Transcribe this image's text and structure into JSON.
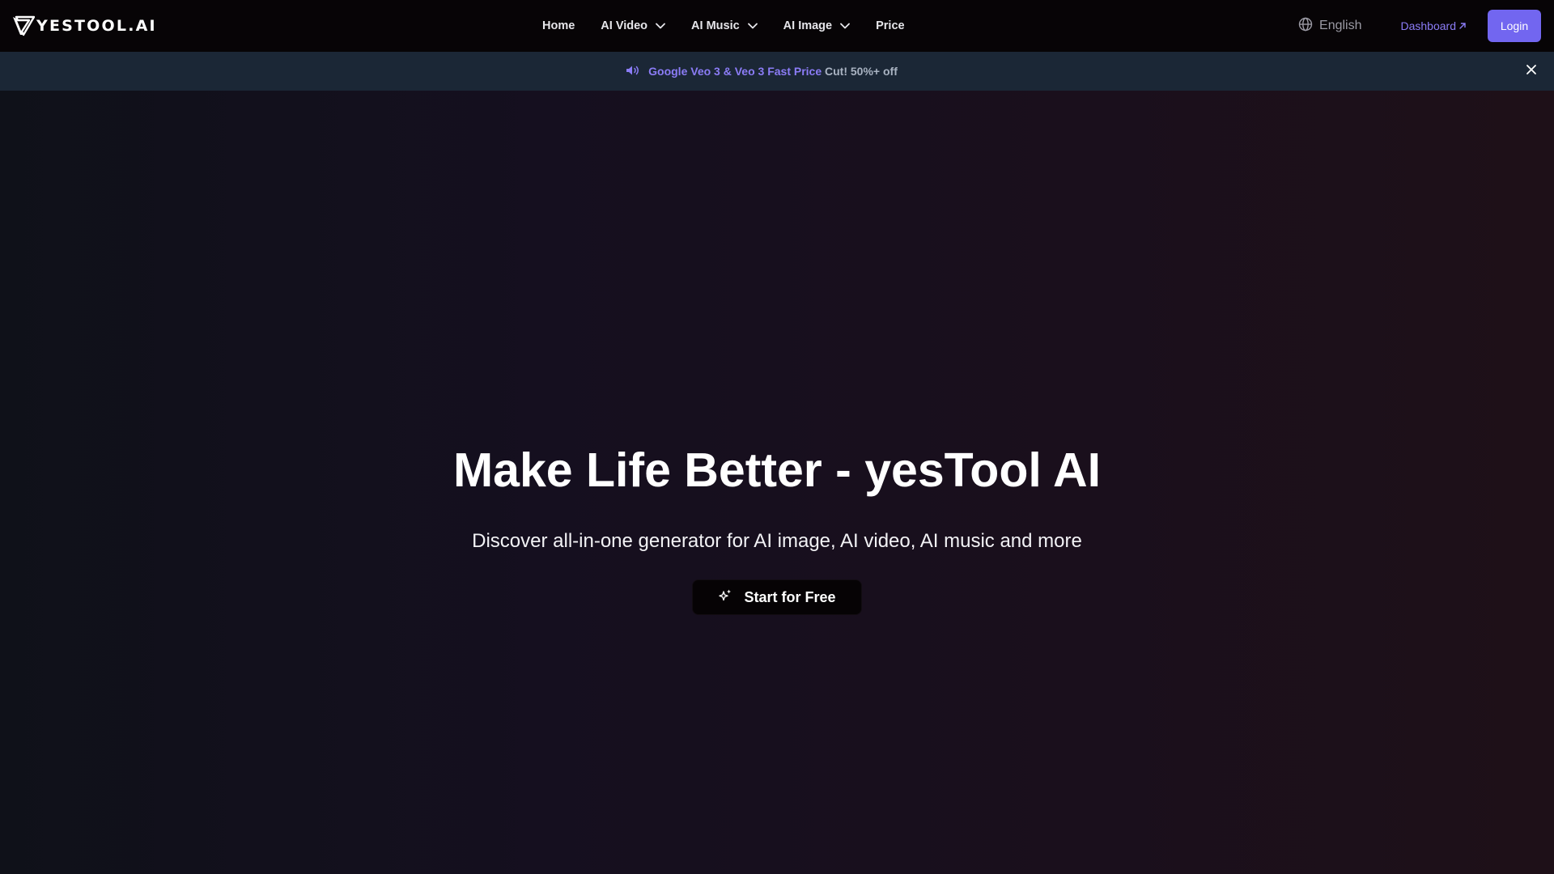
{
  "brand": {
    "logo_text": "YESTOOL.AI"
  },
  "nav": {
    "items": [
      {
        "label": "Home",
        "has_dropdown": false
      },
      {
        "label": "AI Video",
        "has_dropdown": true
      },
      {
        "label": "AI Music",
        "has_dropdown": true
      },
      {
        "label": "AI Image",
        "has_dropdown": true
      },
      {
        "label": "Price",
        "has_dropdown": false
      }
    ],
    "language": "English",
    "dashboard_label": "Dashboard",
    "login_label": "Login"
  },
  "announcement": {
    "highlight": "Google Veo 3 & Veo 3 Fast Price",
    "rest": "Cut! 50%+ off"
  },
  "hero": {
    "title": "Make Life Better - yesTool AI",
    "subtitle": "Discover all-in-one generator for AI image, AI video, AI music and more",
    "cta_label": "Start for Free"
  },
  "colors": {
    "accent": "#7266f0",
    "link": "#8b7cf6",
    "navbar_bg": "#070406",
    "announce_bg": "#1b2736"
  },
  "icons": {
    "logo": "v-mark-logo",
    "chevron": "chevron-down-icon",
    "language": "globe-icon",
    "dashboard": "arrow-up-right-icon",
    "announce": "speaker-icon",
    "close": "close-icon",
    "cta": "sparkles-icon"
  }
}
